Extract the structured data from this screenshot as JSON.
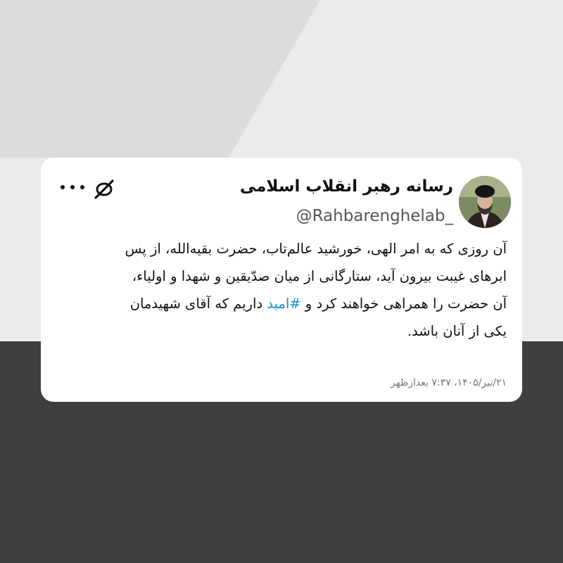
{
  "tweet": {
    "author_name": "رسانه رهبر انقلاب اسلامی",
    "author_handle": "@Rahbarenghelab_",
    "body": {
      "line1": "آن روزی که به امر الهی، خورشید عالم‌تاب، حضرت بقیه‌الله، از پس",
      "line2": "ابرهای غیبت بیرون آید، ستارگانی از میان صدّیقین و شهدا و اولیاء،",
      "line3_before": "آن حضرت را همراهی خواهند کرد و ",
      "hashtag": "#امید",
      "line3_after": " داریم که آقای شهیدمان",
      "line4": "یکی از آنان باشد."
    },
    "timestamp": "۲۱/تیر/۱۴۰۵، ۷:۳۷ بعدازظهر"
  },
  "icons": {
    "avatar": "profile-photo",
    "platform": "x-logo-icon",
    "menu": "more-icon"
  },
  "colors": {
    "background_light": "#ebebeb",
    "background_mid": "#dcdcdc",
    "background_dark": "#3f3f3f",
    "card": "#ffffff",
    "hashtag": "#1d8fd6"
  }
}
